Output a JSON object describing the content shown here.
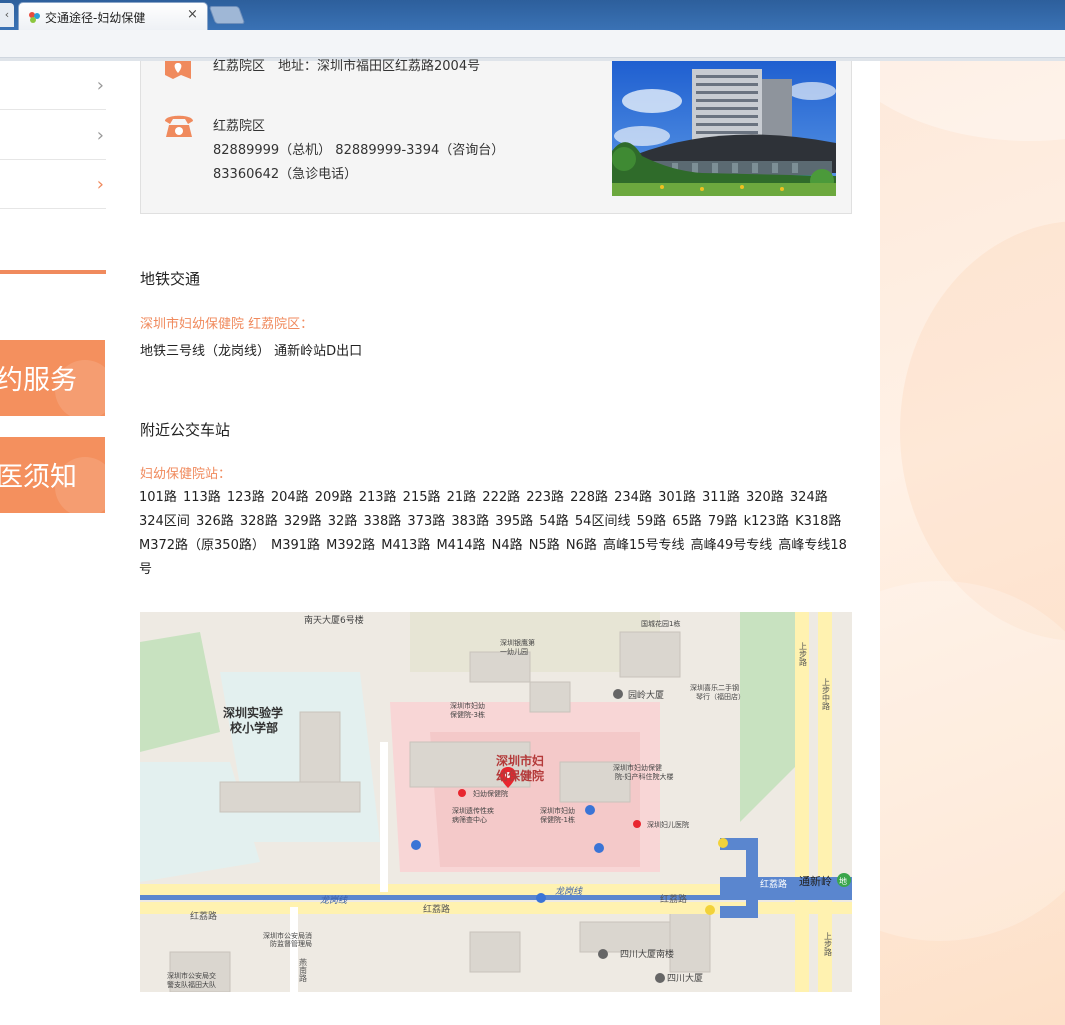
{
  "browser": {
    "tab_title": "交通途径-妇幼保健",
    "tab_close": "×",
    "prev_tab": "‹"
  },
  "sidebar": {
    "items": [
      {
        "chevron": "›",
        "active": false
      },
      {
        "chevron": "›",
        "active": false
      },
      {
        "chevron": "›",
        "active": true
      }
    ],
    "buttons": [
      {
        "label": "约服务"
      },
      {
        "label": "医须知"
      }
    ]
  },
  "contact": {
    "address": "红荔院区　地址：深圳市福田区红荔路2004号",
    "phone_campus": "红荔院区",
    "phone_line1": "82889999（总机） 82889999-3394（咨询台）",
    "phone_line2": "83360642（急诊电话）"
  },
  "metro": {
    "title": "地铁交通",
    "subtitle": "深圳市妇幼保健院 红荔院区：",
    "text": "地铁三号线（龙岗线） 通新岭站D出口"
  },
  "bus": {
    "title": "附近公交车站",
    "subtitle": "妇幼保健院站：",
    "lines": "101路 113路 123路 204路 209路 213路 215路 21路 222路 223路 228路 234路 301路 311路 320路 324路 324区间 326路 328路 329路 32路 338路 373路 383路 395路 54路 54区间线 59路 65路 79路 k123路 K318路 M372路（原350路） M391路 M392路 M413路 M414路 N4路 N5路 N6路 高峰15号专线 高峰49号专线 高峰专线18号"
  },
  "map": {
    "labels": {
      "nantian": "南天大厦6号楼",
      "school": "深圳实验学",
      "school2": "校小学部",
      "kindergarten": "深圳银鹰第",
      "kindergarten2": "一幼儿园",
      "guocui": "国城花园1栋",
      "yuanling": "园岭大厦",
      "music": "深圳喜乐二手钢",
      "music2": "琴行（福田店）",
      "bldg3": "深圳市妇幼",
      "bldg3b": "保健院-3栋",
      "hosp_main": "深圳市妇",
      "hosp_main2": "幼保健院",
      "inpatient": "深圳市妇幼保健",
      "inpatient2": "院-妇产科住院大楼",
      "fuyou": "妇幼保健院",
      "genetic": "深圳遗传性疾",
      "genetic2": "病筛查中心",
      "bldg1": "深圳市妇幼",
      "bldg1b": "保健院-1栋",
      "children": "深圳妇儿医院",
      "longgang1": "龙岗线",
      "longgang2": "龙岗线",
      "honglilu1": "红荔路",
      "honglilu2": "红荔路",
      "honglilu3": "红荔路",
      "tongxinling": "通新岭",
      "honglilu_st": "红荔路",
      "fire": "深圳市公安局消",
      "fire2": "防监督管理局",
      "yannan": "燕南路",
      "traffic": "深圳市公安局交",
      "traffic2": "警支队福田大队",
      "sichuan_s": "四川大厦南楼",
      "sichuan": "四川大厦",
      "shangbu1": "上步路",
      "shangbu2": "上步中路",
      "shangbu3": "上步路",
      "metro_icon": "地"
    }
  },
  "colors": {
    "accent": "#f08a5d",
    "chrome": "#3a72b5"
  }
}
